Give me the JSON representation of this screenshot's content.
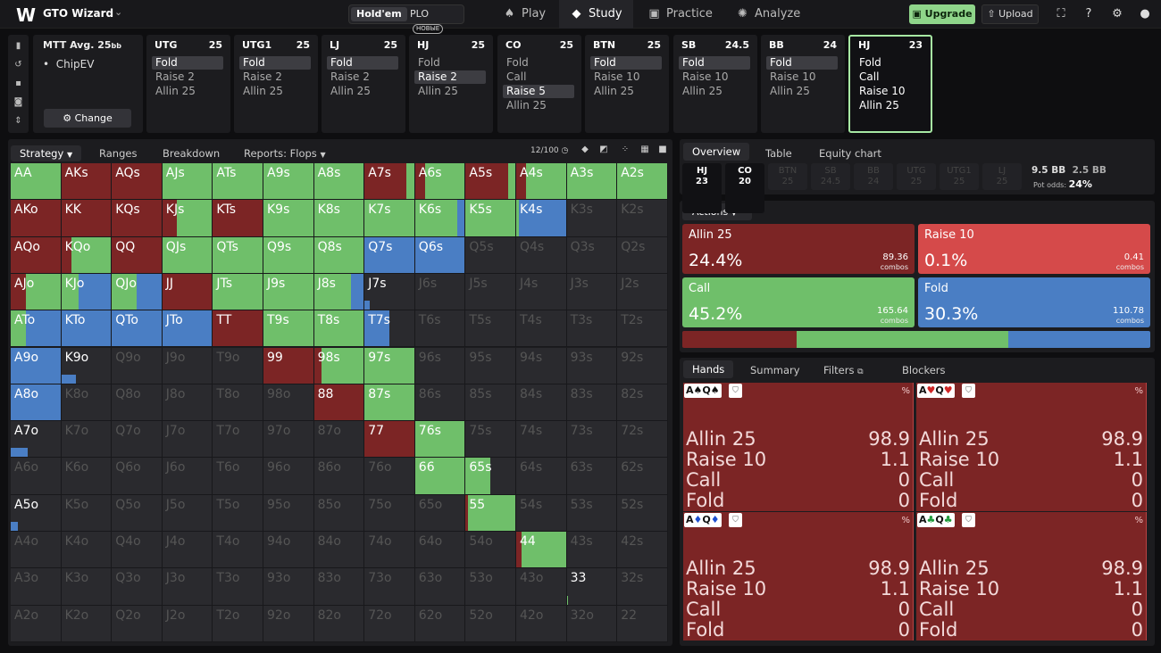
{
  "app": {
    "logo": "W",
    "name": "GTO Wizard"
  },
  "game_type": {
    "holdem": "Hold'em",
    "plo": "PLO",
    "plo_badge": "НОВЫЕ"
  },
  "nav": [
    {
      "icon": "cards-icon",
      "glyph": "♠",
      "label": "Play"
    },
    {
      "icon": "study-icon",
      "glyph": "◆",
      "label": "Study",
      "active": true
    },
    {
      "icon": "gamepad-icon",
      "glyph": "▣",
      "label": "Practice"
    },
    {
      "icon": "analyze-icon",
      "glyph": "✺",
      "label": "Analyze"
    }
  ],
  "upgrade_label": "Upgrade",
  "upload_label": "Upload",
  "colors": {
    "allin": "#7c2525",
    "raise": "#d54a4a",
    "call": "#6fbf6a",
    "fold": "#4a7ec4",
    "accent": "#8fd58a"
  },
  "table_info": {
    "format": "MTT",
    "avg_label": "Avg. 25",
    "avg_unit": "bb",
    "model": "ChipEV",
    "change_label": "Change"
  },
  "positions": [
    {
      "name": "UTG",
      "stack": "25",
      "options": [
        "Fold",
        "Raise 2",
        "Allin 25"
      ],
      "selected": 0
    },
    {
      "name": "UTG1",
      "stack": "25",
      "options": [
        "Fold",
        "Raise 2",
        "Allin 25"
      ],
      "selected": 0
    },
    {
      "name": "LJ",
      "stack": "25",
      "options": [
        "Fold",
        "Raise 2",
        "Allin 25"
      ],
      "selected": 0
    },
    {
      "name": "HJ",
      "stack": "25",
      "options": [
        "Fold",
        "Raise 2",
        "Allin 25"
      ],
      "selected": 1
    },
    {
      "name": "CO",
      "stack": "25",
      "options": [
        "Fold",
        "Call",
        "Raise 5",
        "Allin 25"
      ],
      "selected": 2
    },
    {
      "name": "BTN",
      "stack": "25",
      "options": [
        "Fold",
        "Raise 10",
        "Allin 25"
      ],
      "selected": 0
    },
    {
      "name": "SB",
      "stack": "24.5",
      "options": [
        "Fold",
        "Raise 10",
        "Allin 25"
      ],
      "selected": 0
    },
    {
      "name": "BB",
      "stack": "24",
      "options": [
        "Fold",
        "Raise 10",
        "Allin 25"
      ],
      "selected": 0
    },
    {
      "name": "HJ",
      "stack": "23",
      "options": [
        "Fold",
        "Call",
        "Raise 10",
        "Allin 25"
      ],
      "selected": -1,
      "current": true
    }
  ],
  "left_tabs": {
    "strategy": "Strategy",
    "ranges": "Ranges",
    "breakdown": "Breakdown",
    "reports": "Reports: Flops"
  },
  "hands_counter": "12/100",
  "grid": {
    "ranks": [
      "A",
      "K",
      "Q",
      "J",
      "T",
      "9",
      "8",
      "7",
      "6",
      "5",
      "4",
      "3",
      "2"
    ],
    "cells": {
      "AA": [
        0,
        0,
        1,
        0
      ],
      "AKs": [
        1,
        0,
        0,
        0
      ],
      "AQs": [
        1,
        0,
        0,
        0
      ],
      "AJs": [
        0,
        0,
        1,
        0
      ],
      "ATs": [
        0,
        0,
        1,
        0
      ],
      "A9s": [
        0,
        0,
        1,
        0
      ],
      "A8s": [
        0,
        0,
        1,
        0
      ],
      "A7s": [
        0.85,
        0,
        0.15,
        0
      ],
      "A6s": [
        0.2,
        0,
        0.8,
        0
      ],
      "A5s": [
        0.85,
        0,
        0.15,
        0
      ],
      "A4s": [
        0.2,
        0,
        0.8,
        0
      ],
      "A3s": [
        0,
        0,
        1,
        0
      ],
      "A2s": [
        0,
        0,
        1,
        0
      ],
      "AKo": [
        1,
        0,
        0,
        0
      ],
      "KK": [
        1,
        0,
        0,
        0
      ],
      "KQs": [
        1,
        0,
        0,
        0
      ],
      "KJs": [
        0.3,
        0,
        0.7,
        0
      ],
      "KTs": [
        1,
        0,
        0,
        0
      ],
      "K9s": [
        0,
        0,
        1,
        0
      ],
      "K8s": [
        0,
        0,
        1,
        0
      ],
      "K7s": [
        0,
        0,
        1,
        0
      ],
      "K6s": [
        0,
        0,
        0.85,
        0.15
      ],
      "K5s": [
        0,
        0,
        1,
        0
      ],
      "K4s": [
        0,
        0,
        0.05,
        0.95
      ],
      "AQo": [
        1,
        0,
        0,
        0
      ],
      "KQo": [
        0.2,
        0,
        0.8,
        0
      ],
      "QQ": [
        1,
        0,
        0,
        0
      ],
      "QJs": [
        0,
        0,
        1,
        0
      ],
      "QTs": [
        0,
        0,
        1,
        0
      ],
      "Q9s": [
        0,
        0,
        1,
        0
      ],
      "Q8s": [
        0,
        0,
        1,
        0
      ],
      "Q7s": [
        0,
        0,
        0,
        1
      ],
      "Q6s": [
        0,
        0,
        0,
        1
      ],
      "AJo": [
        0.3,
        0,
        0.7,
        0
      ],
      "KJo": [
        0,
        0,
        0.35,
        0.65
      ],
      "QJo": [
        0,
        0,
        0.5,
        0.5
      ],
      "JJ": [
        1,
        0,
        0,
        0
      ],
      "JTs": [
        0,
        0,
        1,
        0
      ],
      "J9s": [
        0,
        0,
        1,
        0
      ],
      "J8s": [
        0,
        0,
        0.75,
        0.25
      ],
      "J7s": [
        0,
        0,
        0,
        0.1
      ],
      "ATo": [
        0,
        0,
        0.3,
        0.7
      ],
      "KTo": [
        0,
        0,
        0,
        1
      ],
      "QTo": [
        0,
        0,
        0,
        1
      ],
      "JTo": [
        0,
        0,
        0,
        1
      ],
      "TT": [
        1,
        0,
        0,
        0
      ],
      "T9s": [
        0,
        0,
        1,
        0
      ],
      "T8s": [
        0,
        0,
        1,
        0
      ],
      "T7s": [
        0,
        0,
        0,
        0.5
      ],
      "A9o": [
        0,
        0,
        0,
        1
      ],
      "K9o": [
        0,
        0,
        0,
        0.3
      ],
      "99": [
        1,
        0,
        0,
        0
      ],
      "98s": [
        0.15,
        0,
        0.85,
        0
      ],
      "97s": [
        0,
        0,
        1,
        0
      ],
      "A8o": [
        0,
        0,
        0,
        1
      ],
      "88": [
        1,
        0,
        0,
        0
      ],
      "87s": [
        0,
        0,
        1,
        0
      ],
      "A7o": [
        0,
        0,
        0,
        0.35
      ],
      "77": [
        1,
        0,
        0,
        0
      ],
      "76s": [
        0,
        0,
        1,
        0
      ],
      "66": [
        0,
        0,
        1,
        0
      ],
      "65s": [
        0,
        0,
        0.5,
        0
      ],
      "A5o": [
        0,
        0,
        0,
        0.15
      ],
      "55": [
        0.05,
        0,
        0.95,
        0
      ],
      "44": [
        0.1,
        0,
        0.9,
        0
      ],
      "33": [
        0,
        0.01,
        0.01,
        0
      ]
    }
  },
  "right_tabs": {
    "overview": "Overview",
    "table": "Table",
    "equity_chart": "Equity chart"
  },
  "seats": [
    {
      "name": "HJ",
      "stack": "23",
      "active": true
    },
    {
      "name": "CO",
      "stack": "20",
      "active": true
    },
    {
      "name": "BTN",
      "stack": "25"
    },
    {
      "name": "SB",
      "stack": "24.5"
    },
    {
      "name": "BB",
      "stack": "24"
    },
    {
      "name": "UTG",
      "stack": "25"
    },
    {
      "name": "UTG1",
      "stack": "25"
    },
    {
      "name": "LJ",
      "stack": "25"
    }
  ],
  "pot": {
    "bb1": "9.5 BB",
    "bb2": "2.5 BB",
    "odds_label": "Pot odds:",
    "odds": "24%"
  },
  "actions_label": "Actions",
  "actions": [
    {
      "name": "Allin 25",
      "pct": "24.4%",
      "combos": "89.36",
      "color": "#7c2525",
      "freq": 0.244
    },
    {
      "name": "Raise 10",
      "pct": "0.1%",
      "combos": "0.41",
      "color": "#d54a4a",
      "freq": 0.001
    },
    {
      "name": "Call",
      "pct": "45.2%",
      "combos": "165.64",
      "color": "#6fbf6a",
      "freq": 0.452
    },
    {
      "name": "Fold",
      "pct": "30.3%",
      "combos": "110.78",
      "color": "#4a7ec4",
      "freq": 0.303
    }
  ],
  "combos_label": "combos",
  "bottom_tabs": {
    "hands": "Hands",
    "summary": "Summary",
    "filters": "Filters",
    "blockers": "Blockers"
  },
  "hand_cards": [
    {
      "rank1": "A",
      "suit1": "♠",
      "rank2": "Q",
      "suit2": "♠",
      "suit_color": "#111"
    },
    {
      "rank1": "A",
      "suit1": "♥",
      "rank2": "Q",
      "suit2": "♥",
      "suit_color": "#d02525"
    },
    {
      "rank1": "A",
      "suit1": "♦",
      "rank2": "Q",
      "suit2": "♦",
      "suit_color": "#1d4fd0"
    },
    {
      "rank1": "A",
      "suit1": "♣",
      "rank2": "Q",
      "suit2": "♣",
      "suit_color": "#1f9a3a"
    }
  ],
  "hand_stats": [
    {
      "name": "Allin 25",
      "value": "98.9"
    },
    {
      "name": "Raise 10",
      "value": "1.1"
    },
    {
      "name": "Call",
      "value": "0"
    },
    {
      "name": "Fold",
      "value": "0"
    }
  ],
  "pct_sign": "%"
}
